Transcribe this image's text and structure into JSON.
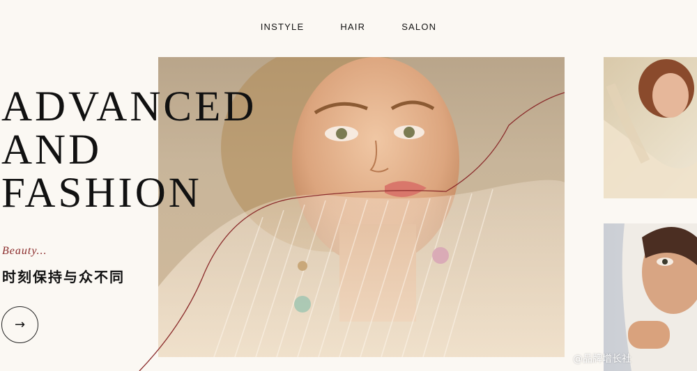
{
  "nav": {
    "items": [
      "INSTYLE",
      "HAIR",
      "SALON"
    ]
  },
  "hero": {
    "headline": "ADVANCED\nAND\nFASHION",
    "kicker": "Beauty...",
    "tagline": "时刻保持与众不同",
    "arrow": "→"
  },
  "watermark": "@品牌增长社",
  "colors": {
    "background": "#fbf8f3",
    "accent": "#8a2a2a",
    "text": "#111111"
  },
  "icons": {
    "arrow": "arrow-right-icon"
  }
}
